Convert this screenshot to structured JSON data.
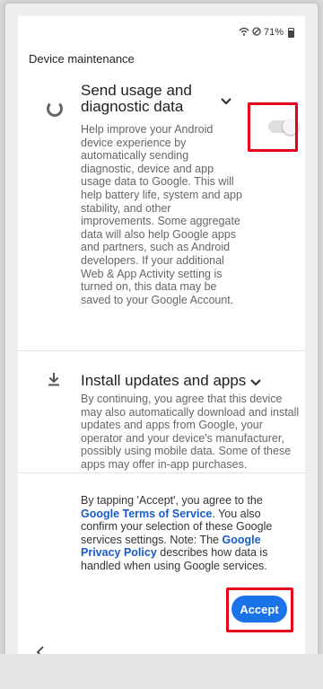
{
  "status_bar": {
    "battery_text": "71%",
    "icons": [
      "wifi-icon",
      "do-not-disturb-icon",
      "battery-icon"
    ]
  },
  "header": {
    "title": "Device maintenance"
  },
  "items": [
    {
      "title_line1": "Send usage and",
      "title_line2": "diagnostic data",
      "description": "Help improve your Android device experience by automatically sending diagnostic, device and app usage data to Google. This will help battery life, system and app stability, and other improvements. Some aggregate data will also help Google apps and partners, such as Android developers. If your additional Web & App Activity setting is turned on, this data may be saved to your Google Account.",
      "icon": "sync-icon",
      "toggle_on": false
    },
    {
      "title": "Install updates and apps",
      "description": "By continuing, you agree that this device may also automatically download and install updates and apps from Google, your operator and your device's manufacturer, possibly using mobile data. Some of these apps may offer in-app purchases.",
      "icon": "download-icon"
    }
  ],
  "terms": {
    "part1": "By tapping 'Accept', you agree to the ",
    "link1": "Google Terms of Service",
    "part2": ". You also confirm your selection of these Google services settings. Note: The ",
    "link2": "Google Privacy Policy",
    "part3": " describes how data is handled when using Google services."
  },
  "buttons": {
    "accept_label": "Accept"
  },
  "colors": {
    "accent": "#1a73e8",
    "highlight": "#e6001b",
    "link": "#1a5cc7"
  }
}
